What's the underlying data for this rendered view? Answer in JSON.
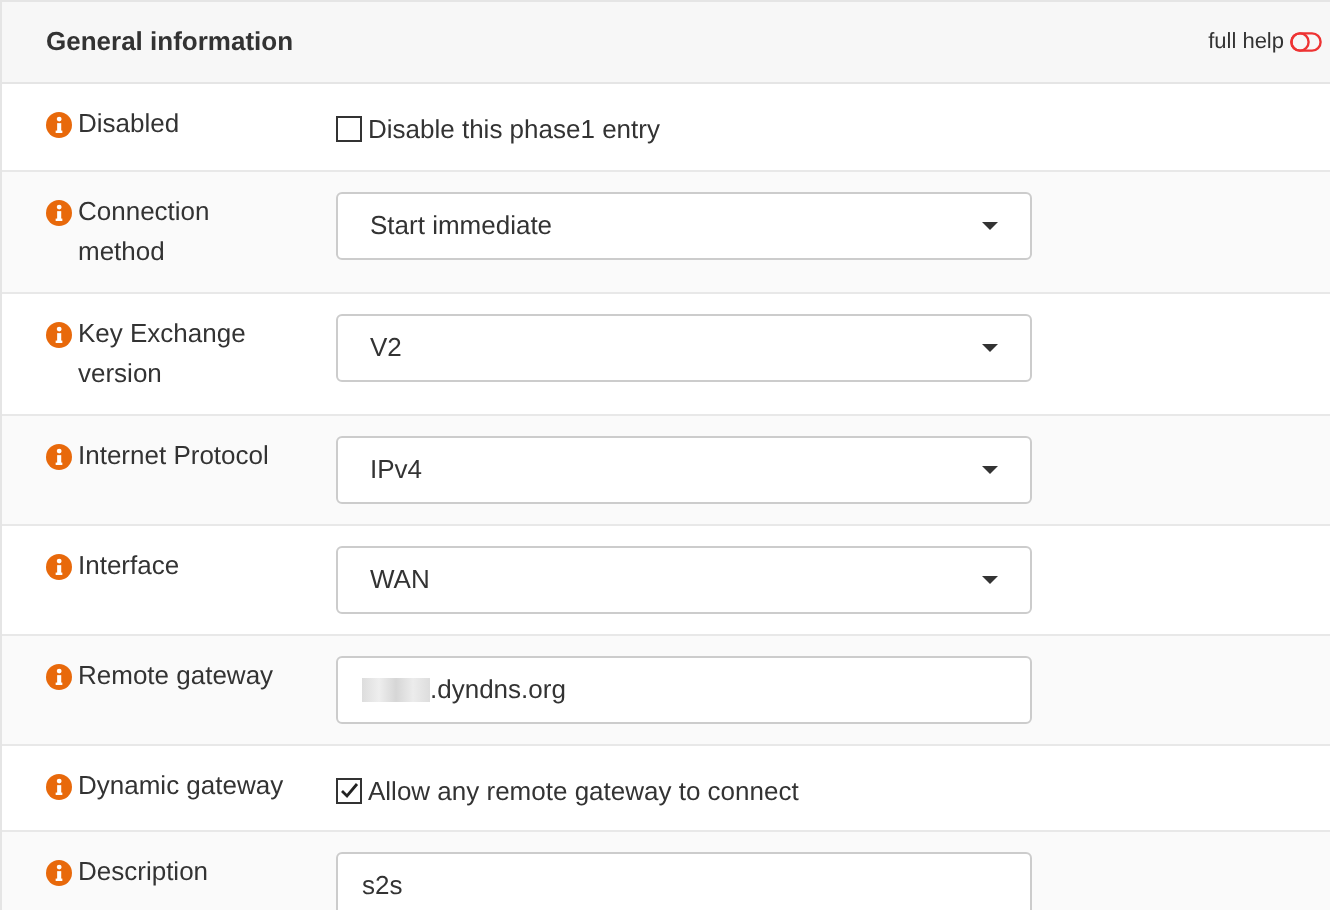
{
  "section": {
    "title": "General information",
    "full_help": {
      "label": "full help",
      "on": false
    }
  },
  "rows": [
    {
      "kind": "checkbox",
      "label": "Disabled",
      "text": "Disable this phase1 entry",
      "checked": false
    },
    {
      "kind": "select",
      "label": "Connection method",
      "value": "Start immediate"
    },
    {
      "kind": "select",
      "label": "Key Exchange version",
      "value": "V2"
    },
    {
      "kind": "select",
      "label": "Internet Protocol",
      "value": "IPv4"
    },
    {
      "kind": "select",
      "label": "Interface",
      "value": "WAN"
    },
    {
      "kind": "text",
      "label": "Remote gateway",
      "value": ".dyndns.org",
      "redacted": true
    },
    {
      "kind": "checkbox",
      "label": "Dynamic gateway",
      "text": "Allow any remote gateway to connect",
      "checked": true
    },
    {
      "kind": "text",
      "label": "Description",
      "value": "s2s"
    }
  ]
}
